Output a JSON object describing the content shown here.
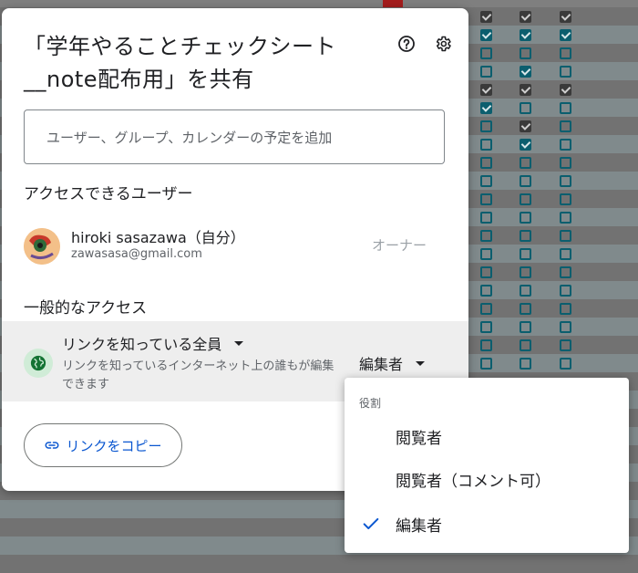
{
  "dialog": {
    "title": "「学年やることチェックシート__note配布用」を共有",
    "add_placeholder": "ユーザー、グループ、カレンダーの予定を追加",
    "people_heading": "アクセスできるユーザー",
    "user": {
      "name": "hiroki sasazawa（自分）",
      "email": "zawasasa@gmail.com",
      "role": "オーナー"
    },
    "general_heading": "一般的なアクセス",
    "general": {
      "scope": "リンクを知っている全員",
      "description": "リンクを知っているインターネット上の誰もが編集できます",
      "role": "編集者"
    },
    "copy_link_label": "リンクをコピー"
  },
  "role_menu": {
    "heading": "役割",
    "items": [
      {
        "label": "閲覧者",
        "selected": false
      },
      {
        "label": "閲覧者（コメント可）",
        "selected": false
      },
      {
        "label": "編集者",
        "selected": true
      }
    ]
  },
  "colors": {
    "accent": "#0b57d0",
    "access_row_bg": "#eeeeee",
    "globe_bg": "#d0ecd7"
  },
  "icons": [
    "help-icon",
    "settings-icon",
    "globe-icon",
    "dropdown-arrow-icon",
    "link-icon",
    "checkmark-icon"
  ]
}
